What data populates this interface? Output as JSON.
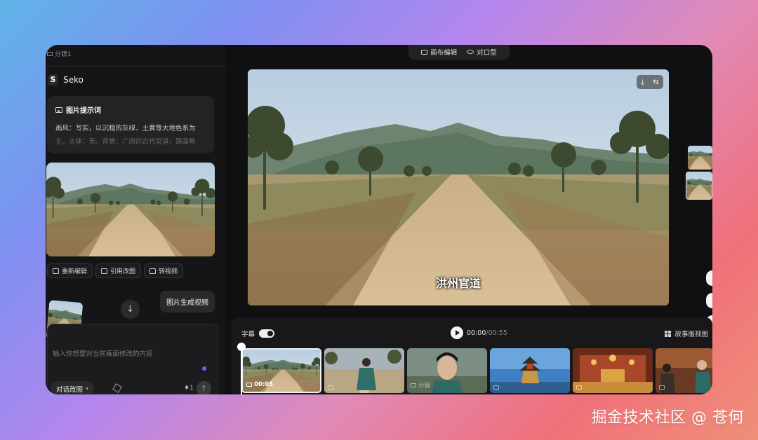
{
  "left_panel": {
    "shot_tab": "分镜1",
    "brand": "Seko",
    "prompt_card": {
      "title": "图片提示词",
      "line1": "画风：写实，以沉稳的灰绿、土黄等大地色系为",
      "line2": "主。主体：无。背景：广阔的古代官道，路面略"
    },
    "chips": [
      "重新编辑",
      "引用改图",
      "转视频"
    ],
    "generate_video": "图片生成视频",
    "input_placeholder": "输入你想要对当前画面修改的内容",
    "chat_mode": "对话改图",
    "chat_mode_caret": "▾",
    "credit": "♦1",
    "send_icon": "↑",
    "down_icon": "↓"
  },
  "toolbar": {
    "canvas_edit": "画布编辑",
    "lip_sync": "对口型"
  },
  "preview": {
    "subtitle": "洪州官道",
    "download_icon": "⤓",
    "swap_icon": "⇆"
  },
  "timeline": {
    "subtitle_toggle": "字幕",
    "subtitle_on": true,
    "current_time": "00:00",
    "total_time": "/00:55",
    "storyboard_view": "故事版视图",
    "clips": [
      {
        "label": "00:05",
        "active": true
      },
      {
        "label": "",
        "active": false
      },
      {
        "label": "分镜",
        "active": false
      },
      {
        "label": "",
        "active": false
      },
      {
        "label": "",
        "active": false
      },
      {
        "label": "",
        "active": false
      }
    ]
  },
  "watermark": "掘金技术社区 @ 苍何",
  "colors": {
    "app_bg": "#101012",
    "panel_bg": "#151517",
    "accent_purple": "#7c5cff"
  }
}
